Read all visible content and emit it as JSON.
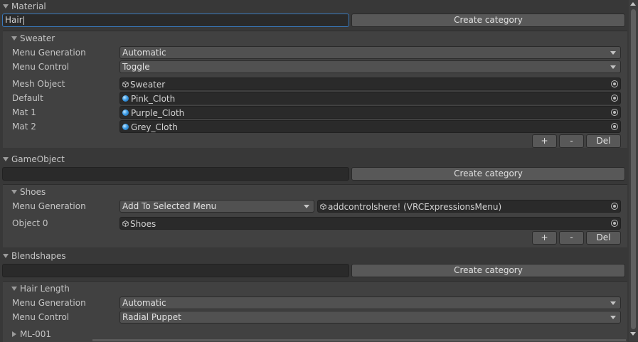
{
  "sections": [
    {
      "title": "Material",
      "name_input": "Hair",
      "create_label": "Create category",
      "group": {
        "title": "Sweater",
        "menu_generation_label": "Menu Generation",
        "menu_generation_value": "Automatic",
        "menu_control_label": "Menu Control",
        "menu_control_value": "Toggle",
        "mesh_object_label": "Mesh Object",
        "mesh_object_value": "Sweater",
        "rows": [
          {
            "label": "Default",
            "value": "Pink_Cloth"
          },
          {
            "label": "Mat 1",
            "value": "Purple_Cloth"
          },
          {
            "label": "Mat 2",
            "value": "Grey_Cloth"
          }
        ],
        "plus": "+",
        "minus": "-",
        "del": "Del"
      }
    },
    {
      "title": "GameObject",
      "name_input": "",
      "create_label": "Create category",
      "group": {
        "title": "Shoes",
        "menu_generation_label": "Menu Generation",
        "menu_generation_value": "Add To Selected Menu",
        "menu_target_value": "addcontrolshere! (VRCExpressionsMenu)",
        "object_label": "Object 0",
        "object_value": "Shoes",
        "plus": "+",
        "minus": "-",
        "del": "Del"
      }
    },
    {
      "title": "Blendshapes",
      "name_input": "",
      "create_label": "Create category",
      "group": {
        "title": "Hair Length",
        "menu_generation_label": "Menu Generation",
        "menu_generation_value": "Automatic",
        "menu_control_label": "Menu Control",
        "menu_control_value": "Radial Puppet",
        "sub_title": "ML-001"
      }
    }
  ],
  "icons": {
    "cube": "cube-icon",
    "material": "material-sphere-icon",
    "picker": "object-picker-icon"
  },
  "colors": {
    "background": "#383838",
    "panel": "#414141",
    "field": "#2a2a2a",
    "focus": "#3a79bb"
  }
}
